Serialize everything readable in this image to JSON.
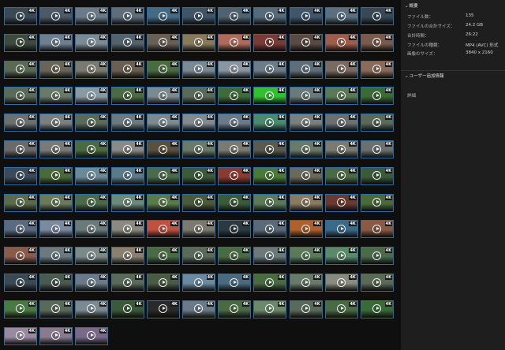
{
  "grid": {
    "badge_label": "4K",
    "rows": [
      {
        "cols": 11,
        "colors": [
          "#3a4a55",
          "#4b5a66",
          "#6a7a88",
          "#5d6d7a",
          "#456a85",
          "#3f5468",
          "#4e6270",
          "#556b7c",
          "#40566a",
          "#5a7080",
          "#394856"
        ]
      },
      {
        "cols": 11,
        "colors": [
          "#3d4a3f",
          "#6f7f90",
          "#7c8a95",
          "#54626d",
          "#6a5f55",
          "#8a7a5c",
          "#b06a5a",
          "#7a3a35",
          "#5a4a44",
          "#a05c4a",
          "#7a5a4c"
        ]
      },
      {
        "cols": 11,
        "colors": [
          "#5a6a55",
          "#6a6558",
          "#7a7a70",
          "#6a5f50",
          "#4a6a40",
          "#7a8a95",
          "#8a95a0",
          "#6c7c88",
          "#5f6f7a",
          "#7a6a62",
          "#8a6a5a"
        ]
      },
      {
        "cols": 11,
        "colors": [
          "#5a6a5a",
          "#6a7a6a",
          "#8a9aa5",
          "#4a6a44",
          "#7a8a90",
          "#5a6a5a",
          "#3f6a3a",
          "#30c030",
          "#6a7a7a",
          "#5a7a55",
          "#3a6a35"
        ]
      },
      {
        "cols": 11,
        "colors": [
          "#6a7070",
          "#7a8080",
          "#5a6a5a",
          "#6a7a80",
          "#7a8a90",
          "#808a90",
          "#6a7a88",
          "#4a8a70",
          "#7a8080",
          "#6a7070",
          "#5a6a5a"
        ]
      },
      {
        "cols": 11,
        "colors": [
          "#6a6a6a",
          "#7a7a78",
          "#4a6a40",
          "#8a8a88",
          "#5a5040",
          "#6a7a6a",
          "#7a7a70",
          "#5a5a50",
          "#6a7a6a",
          "#7a7a70",
          "#6a7070"
        ]
      },
      {
        "cols": 11,
        "colors": [
          "#3a4a5a",
          "#4a6a3a",
          "#6a8a9a",
          "#5a7a8a",
          "#4a6a4a",
          "#3a5a3a",
          "#8a3a30",
          "#4a7a3a",
          "#6a6a5a",
          "#4a6a44",
          "#3a5a3a"
        ]
      },
      {
        "cols": 11,
        "colors": [
          "#5a6a4a",
          "#6a7a5a",
          "#4a6a4a",
          "#6a8a7a",
          "#5a7a4a",
          "#4a5a3a",
          "#3a5a3a",
          "#5a7a5a",
          "#8a7a60",
          "#6a3a30",
          "#4a6a3a"
        ]
      },
      {
        "cols": 11,
        "colors": [
          "#5a6a80",
          "#7a8aa0",
          "#6a7a7a",
          "#8a8a80",
          "#c05040",
          "#7a7a70",
          "#2a3a40",
          "#5a6a7a",
          "#b0602a",
          "#3a6a8a",
          "#8a5a44"
        ]
      },
      {
        "cols": 11,
        "colors": [
          "#8a5a4a",
          "#6a7a80",
          "#7a8a88",
          "#8a8070",
          "#4a6a44",
          "#5a6a5a",
          "#4a6a44",
          "#6a7a7a",
          "#5a7a5a",
          "#5a8a6a",
          "#4a6a4a"
        ]
      },
      {
        "cols": 11,
        "colors": [
          "#3a4a55",
          "#4a5a50",
          "#6a7a88",
          "#5a6a5a",
          "#4a5a44",
          "#6a8aa0",
          "#4a6a80",
          "#4a6a40",
          "#6a7a6a",
          "#8a8a80",
          "#5a6a55"
        ]
      },
      {
        "cols": 11,
        "colors": [
          "#4a7a44",
          "#5a6a5a",
          "#7a8a90",
          "#3a5a3a",
          "#2a2a2a",
          "#6a7a88",
          "#4a6a44",
          "#6a8a6a",
          "#5a6a5a",
          "#4a6a44",
          "#3a6a3a"
        ]
      },
      {
        "cols": 3,
        "colors": [
          "#9a8aa0",
          "#8a7a90",
          "#7a6a8a"
        ]
      }
    ]
  },
  "panel": {
    "overview_title": "概要",
    "properties": [
      {
        "key": "ファイル数：",
        "value": "135"
      },
      {
        "key": "ファイルの合計サイズ：",
        "value": "24.2 GB"
      },
      {
        "key": "合計時間：",
        "value": "26:22"
      },
      {
        "key": "ファイルの種類：",
        "value": "MP4 (AVC) 形式"
      },
      {
        "key": "画像のサイズ：",
        "value": "3840 x 2160"
      }
    ],
    "user_info_title": "ユーザー追加情報",
    "details_label": "詳細"
  }
}
